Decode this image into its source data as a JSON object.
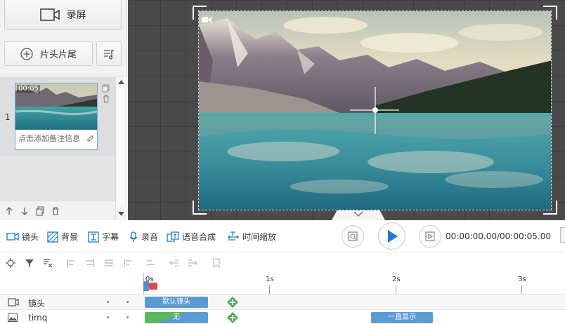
{
  "left_panel": {
    "record_label": "录屏",
    "intro_label": "片头片尾",
    "scene_number": "1",
    "scene_duration": "00:05",
    "scene_note": "点击添加备注信息"
  },
  "toolbar": {
    "items": [
      {
        "label": "镜头",
        "icon": "camera-icon"
      },
      {
        "label": "背景",
        "icon": "background-icon"
      },
      {
        "label": "字幕",
        "icon": "subtitle-icon"
      },
      {
        "label": "录音",
        "icon": "microphone-icon"
      },
      {
        "label": "语音合成",
        "icon": "speech-synthesis-icon"
      },
      {
        "label": "时间缩放",
        "icon": "time-scale-icon"
      }
    ],
    "time_display": "00:00:00.00/00:00:05.00"
  },
  "timeline": {
    "ruler_labels": [
      "0s",
      "1s",
      "2s",
      "3s"
    ],
    "tracks": [
      {
        "name": "镜头",
        "clip_label": "默认镜头"
      },
      {
        "name": "timq",
        "clip_label": "无",
        "clip2_label": "一直显示"
      }
    ]
  },
  "colors": {
    "accent": "#1a78d8",
    "clip_blue": "#5b9bd5",
    "clip_green": "#5cb85c",
    "plus_green": "#4caf50",
    "playhead_red": "#e04848"
  }
}
